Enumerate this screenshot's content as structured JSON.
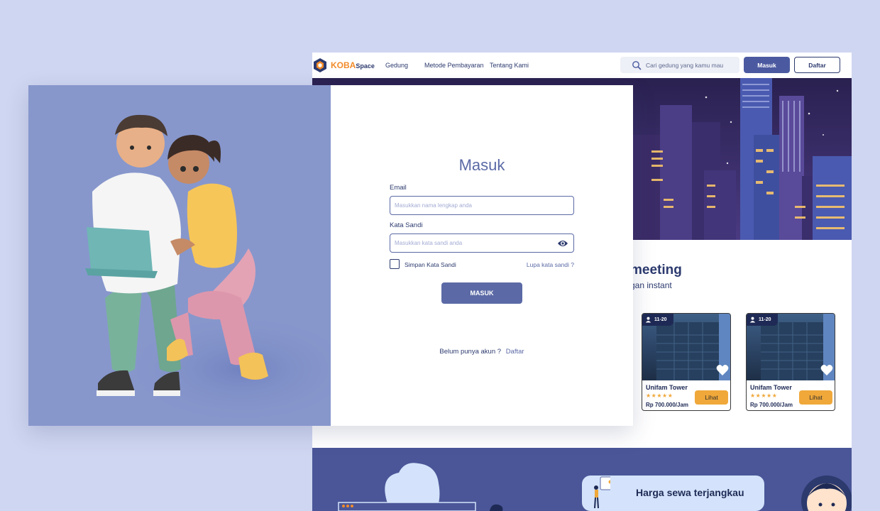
{
  "site": {
    "brand": {
      "primary": "KOBA",
      "secondary": "Space"
    },
    "nav_links": [
      "Gedung",
      "Metode Pembayaran",
      "Tentang Kami"
    ],
    "search": {
      "placeholder": "Cari gedung yang kamu mau"
    },
    "login_label": "Masuk",
    "register_label": "Daftar",
    "section_title": "meeting",
    "section_sub": "gan instant",
    "cards": [
      {
        "capacity": "11-20",
        "name": "Unifam Tower",
        "stars": "★★★★★",
        "price": "Rp 700.000/Jam",
        "button": "Lihat"
      },
      {
        "capacity": "11-20",
        "name": "Unifam Tower",
        "stars": "★★★★★",
        "price": "Rp 700.000/Jam",
        "button": "Lihat"
      }
    ],
    "feature": {
      "label": "Harga sewa terjangkau"
    }
  },
  "login": {
    "title": "Masuk",
    "email_label": "Email",
    "email_placeholder": "Masukkan nama lengkap anda",
    "password_label": "Kata Sandi",
    "password_placeholder": "Masukkan kata sandi anda",
    "remember_label": "Simpan Kata Sandi",
    "forgot_label": "Lupa kata sandi ?",
    "submit_label": "MASUK",
    "no_account_text": "Belum punya akun ?",
    "register_link": "Daftar"
  },
  "colors": {
    "page_bg": "#cfd6f1",
    "primary": "#5b6aa6",
    "nav_button": "#4b5aa0",
    "accent": "#f0a83a",
    "brand_orange": "#f28b2a",
    "dark_text": "#2c3a6e",
    "illustration_bg": "#8797cc"
  },
  "icons": [
    "logo-icon",
    "search-icon",
    "eye-icon",
    "person-icon",
    "heart-icon"
  ]
}
